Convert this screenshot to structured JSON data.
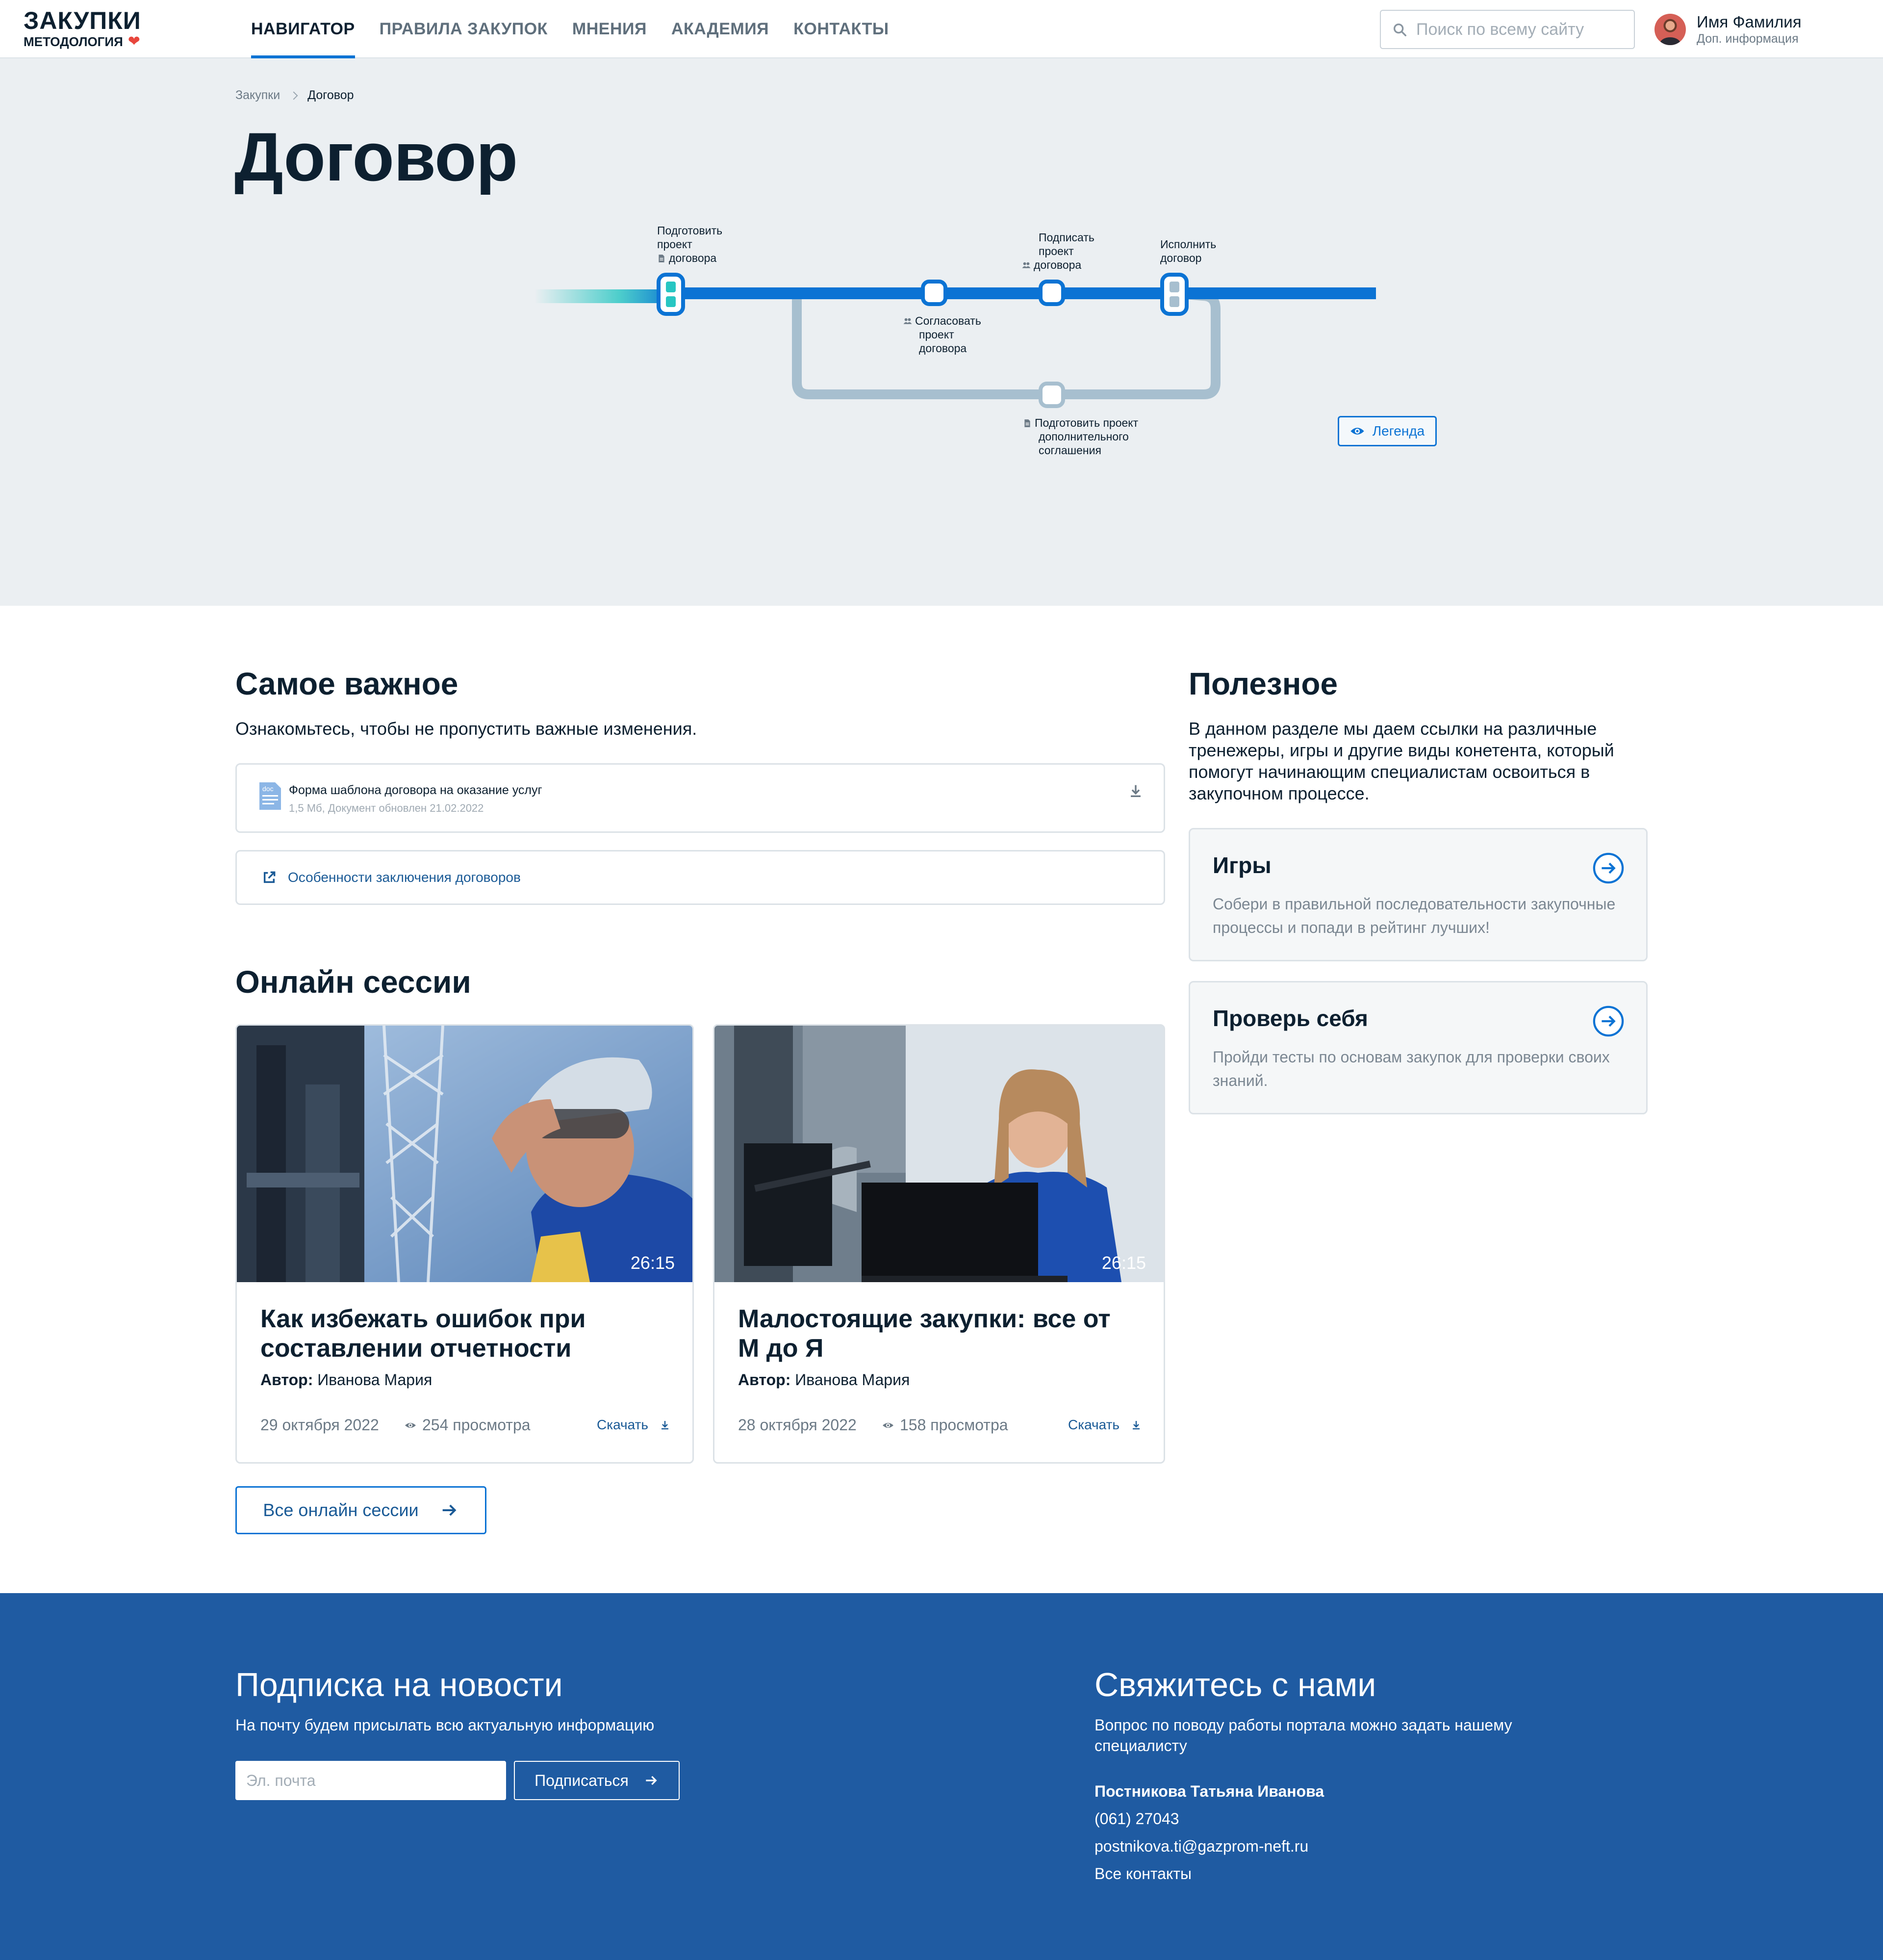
{
  "header": {
    "logo_title": "ЗАКУПКИ",
    "logo_sub": "МЕТОДОЛОГИЯ",
    "nav": [
      {
        "label": "НАВИГАТОР"
      },
      {
        "label": "ПРАВИЛА ЗАКУПОК"
      },
      {
        "label": "МНЕНИЯ"
      },
      {
        "label": "АКАДЕМИЯ"
      },
      {
        "label": "КОНТАКТЫ"
      }
    ],
    "search_placeholder": "Поиск по всему сайту",
    "user_name": "Имя Фамилия",
    "user_info": "Доп. информация"
  },
  "breadcrumb": {
    "parent": "Закупки",
    "current": "Договор"
  },
  "page_title": "Договор",
  "metro": {
    "stations": [
      {
        "lines": [
          "Подготовить",
          "проект",
          "договора"
        ],
        "icon": "document-icon"
      },
      {
        "lines": [
          "Согласовать",
          "проект",
          "договора"
        ],
        "icon": "people-icon"
      },
      {
        "lines": [
          "Подписать",
          "проект",
          "договора"
        ],
        "icon": "people-icon"
      },
      {
        "lines": [
          "Исполнить",
          "договор"
        ],
        "icon": ""
      },
      {
        "lines": [
          "Подготовить проект",
          "дополнительного",
          "соглашения"
        ],
        "icon": "document-icon"
      }
    ],
    "legend_label": "Легенда"
  },
  "important": {
    "title": "Самое важное",
    "lead": "Ознакомьтесь, чтобы не пропустить важные изменения.",
    "doc_name": "Форма шаблона договора на оказание услуг",
    "doc_meta": "1,5 Мб, Документ обновлен 21.02.2022",
    "doc_icon_label": "doc",
    "link_label": "Особенности заключения договоров"
  },
  "sessions": {
    "title": "Онлайн сессии",
    "items": [
      {
        "duration": "26:15",
        "title": "Как избежать ошибок при составлении отчетности",
        "author_label": "Автор:",
        "author": "Иванова Мария",
        "date": "29 октября 2022",
        "views": "254 просмотра",
        "download": "Скачать"
      },
      {
        "duration": "26:15",
        "title": "Малостоящие закупки: все от М до Я",
        "author_label": "Автор:",
        "author": "Иванова Мария",
        "date": "28 октября 2022",
        "views": "158 просмотра",
        "download": "Скачать"
      }
    ],
    "all_label": "Все онлайн сессии"
  },
  "useful": {
    "title": "Полезное",
    "lead": "В данном разделе мы даем ссылки на различные тренежеры, игры и другие виды конетента, который помогут начинающим специалистам освоиться в закупочном процессе.",
    "cards": [
      {
        "title": "Игры",
        "desc": "Собери в правильной последовательности закупочные процессы и попади в рейтинг лучших!"
      },
      {
        "title": "Проверь себя",
        "desc": "Пройди тесты по основам закупок для проверки своих знаний."
      }
    ]
  },
  "footer": {
    "subscribe_title": "Подписка на новости",
    "subscribe_text": "На почту будем присылать всю актуальную информацию",
    "email_placeholder": "Эл. почта",
    "subscribe_button": "Подписаться",
    "contact_title": "Свяжитесь с нами",
    "contact_text": "Вопрос по поводу работы портала можно задать нашему специалисту",
    "contact_name": "Постникова Татьяна Иванова",
    "contact_phone": "(061) 27043",
    "contact_email": "postnikova.ti@gazprom-neft.ru",
    "all_contacts": "Все контакты"
  },
  "colors": {
    "accent": "#0b73d4",
    "text_dark": "#0d2030",
    "hero_bg": "#ebeff2",
    "footer_bg": "#1f5ba2",
    "metro_main": "#0b73d4",
    "metro_branch": "#a7bfcf",
    "metro_start_gradient": "#27c6c2",
    "heart": "#e8463c"
  }
}
